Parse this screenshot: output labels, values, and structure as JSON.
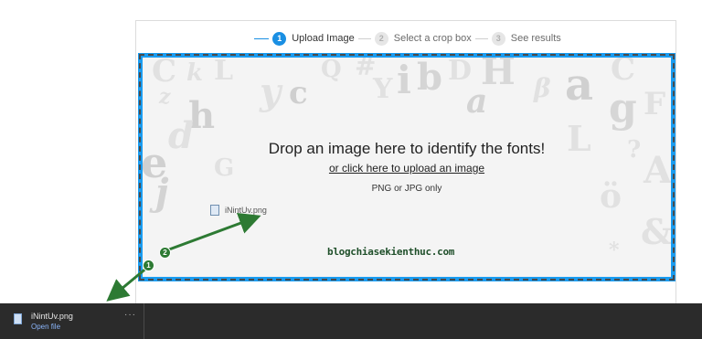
{
  "stepper": {
    "steps": [
      {
        "number": "1",
        "label": "Upload Image",
        "active": true
      },
      {
        "number": "2",
        "label": "Select a crop box",
        "active": false
      },
      {
        "number": "3",
        "label": "See results",
        "active": false
      }
    ]
  },
  "dropzone": {
    "heading": "Drop an image here to identify the fonts!",
    "upload_link": "or click here to upload an image",
    "format_note": "PNG or JPG only",
    "dragged_file_label": "iNintUv.png",
    "watermark": "blogchiasekienthuc.com",
    "border_color": "#1a9cf0"
  },
  "annotations": {
    "badge_1": "1",
    "badge_2": "2",
    "arrow_color": "#2d7a33"
  },
  "download_bar": {
    "file_name": "iNintUv.png",
    "action": "Open file",
    "more_label": "···",
    "file_icon": "image-file-icon"
  }
}
